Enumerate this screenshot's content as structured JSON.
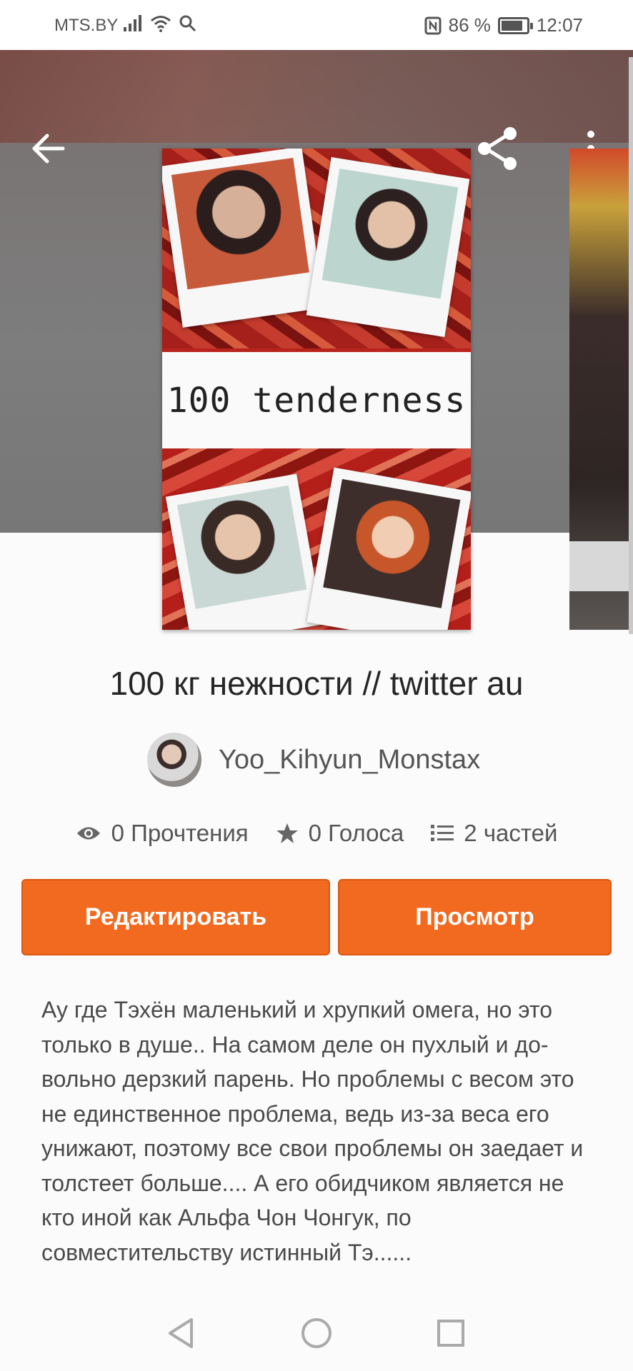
{
  "status_bar": {
    "carrier": "MTS.BY",
    "battery_percent": "86 %",
    "battery_level": 0.86,
    "time": "12:07"
  },
  "toolbar": {
    "back_icon": "arrow-left-icon",
    "share_icon": "share-icon",
    "more_icon": "more-vert-icon"
  },
  "cover": {
    "title": "100 tenderness"
  },
  "book": {
    "title": "100 кг нежности // twitter au",
    "author": "Yoo_Kihyun_Monstax"
  },
  "stats": {
    "reads": "0 Прочтения",
    "votes": "0 Голоса",
    "parts": "2 частей"
  },
  "actions": {
    "edit_label": "Редактировать",
    "view_label": "Просмотр"
  },
  "description": "Ау где Тэхён маленький и хрупкий омега, но это только в душе.. На самом деле он пухлый и до-вольно дерзкий парень. Но проблемы с весом это не единственное проблема, ведь из-за веса его унижают, поэтому все свои проблемы он заедает и толстеет больше.... А его обидчиком является не кто иной как Альфа Чон Чонгук, по совместительству истинный Тэ......",
  "colors": {
    "accent": "#f26a1f",
    "text": "#262626"
  }
}
